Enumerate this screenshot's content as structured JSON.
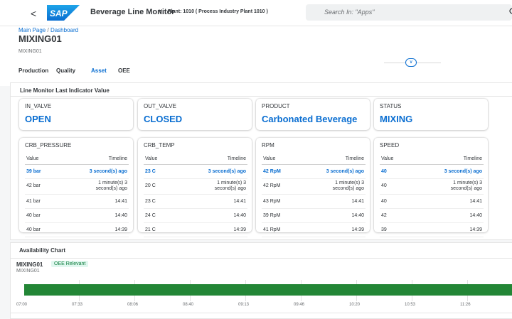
{
  "shell": {
    "back_glyph": "<",
    "logo_text": "SAP",
    "app_title": "Beverage Line Monitor",
    "app_chevron": "∨",
    "plant": "Plant: 1010 ( Process Industry Plant 1010 )",
    "search_placeholder": "Search In: \"Apps\"",
    "search_icon": "search-icon"
  },
  "header": {
    "breadcrumb_home": "Main Page",
    "breadcrumb_sep": "/",
    "breadcrumb_current": "Dashboard",
    "title": "MIXING01",
    "subtitle": "MIXING01",
    "collapse_glyph": "∨"
  },
  "tabs": [
    {
      "label": "Production"
    },
    {
      "label": "Quality"
    },
    {
      "label": "Asset",
      "active": true
    },
    {
      "label": "OEE"
    }
  ],
  "section1": {
    "title": "Line Monitor Last Indicator Value",
    "kpis": [
      {
        "label": "IN_VALVE",
        "value": "OPEN"
      },
      {
        "label": "OUT_VALVE",
        "value": "CLOSED"
      },
      {
        "label": "PRODUCT",
        "value": "Carbonated Beverage"
      },
      {
        "label": "STATUS",
        "value": "MIXING"
      }
    ],
    "table_headers": {
      "value": "Value",
      "timeline": "Timeline"
    },
    "tables": [
      {
        "title": "CRB_PRESSURE",
        "rows": [
          {
            "value": "39 bar",
            "time": "3 second(s) ago"
          },
          {
            "value": "42 bar",
            "time_line1": "1 minute(s) 3",
            "time_line2": "second(s) ago"
          },
          {
            "value": "41 bar",
            "time": "14:41"
          },
          {
            "value": "40 bar",
            "time": "14:40"
          },
          {
            "value": "40 bar",
            "time": "14:39"
          }
        ]
      },
      {
        "title": "CRB_TEMP",
        "rows": [
          {
            "value": "23 C",
            "time": "3 second(s) ago"
          },
          {
            "value": "20 C",
            "time_line1": "1 minute(s) 3",
            "time_line2": "second(s) ago"
          },
          {
            "value": "23 C",
            "time": "14:41"
          },
          {
            "value": "24 C",
            "time": "14:40"
          },
          {
            "value": "21 C",
            "time": "14:39"
          }
        ]
      },
      {
        "title": "RPM",
        "rows": [
          {
            "value": "42 RpM",
            "time": "3 second(s) ago"
          },
          {
            "value": "42 RpM",
            "time_line1": "1 minute(s) 3",
            "time_line2": "second(s) ago"
          },
          {
            "value": "43 RpM",
            "time": "14:41"
          },
          {
            "value": "39 RpM",
            "time": "14:40"
          },
          {
            "value": "41 RpM",
            "time": "14:39"
          }
        ]
      },
      {
        "title": "SPEED",
        "rows": [
          {
            "value": "40",
            "time": "3 second(s) ago"
          },
          {
            "value": "40",
            "time_line1": "1 minute(s) 3",
            "time_line2": "second(s) ago"
          },
          {
            "value": "40",
            "time": "14:41"
          },
          {
            "value": "42",
            "time": "14:40"
          },
          {
            "value": "39",
            "time": "14:39"
          }
        ]
      }
    ]
  },
  "availability": {
    "title": "Availability Chart",
    "resource": "MIXING01",
    "badge": "OEE Relevant",
    "resource_sub": "MIXING01",
    "bar_color": "#238636",
    "time_labels": [
      "07:00",
      "07:33",
      "08:06",
      "08:40",
      "09:13",
      "09:46",
      "10:20",
      "10:53",
      "11:26"
    ]
  },
  "colors": {
    "accent": "#0a6ed1",
    "status_green": "#238636",
    "logo_blue": "#0a6ed1"
  }
}
